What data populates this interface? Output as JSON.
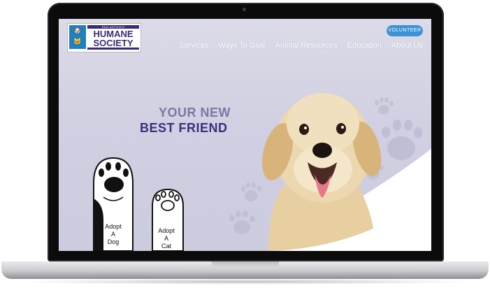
{
  "logo": {
    "top_line": "SAN ANTONIO",
    "line1": "HUMANE",
    "line2": "SOCIETY"
  },
  "header": {
    "volunteer_label": "VOLUNTEER",
    "nav": [
      "Services",
      "Ways To Give",
      "Animal Resources",
      "Education",
      "About Us"
    ]
  },
  "hero": {
    "line1": "YOUR NEW",
    "line2": "BEST FRIEND"
  },
  "adopt": {
    "dog_label": [
      "Adopt",
      "A",
      "Dog"
    ],
    "cat_label": [
      "Adopt",
      "A",
      "Cat"
    ]
  },
  "colors": {
    "brand_purple": "#3b2f7d",
    "accent_blue": "#3b93d6",
    "logo_blue": "#1f7fbf"
  },
  "icons": [
    "paw-print-icon",
    "dog-head-icon",
    "cat-head-icon"
  ]
}
